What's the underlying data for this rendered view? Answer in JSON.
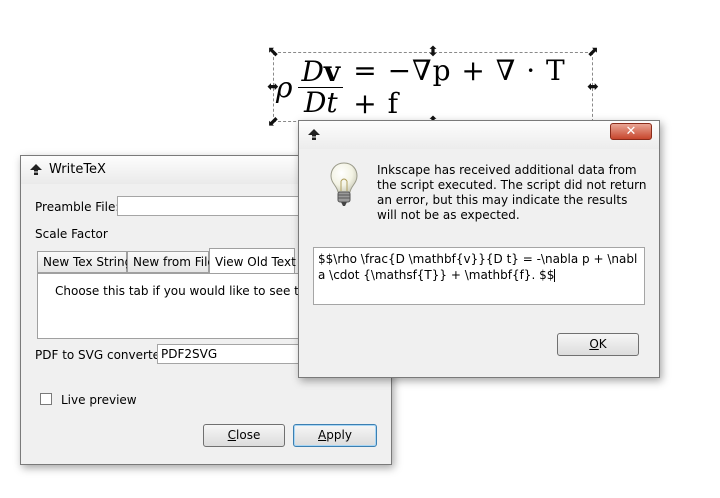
{
  "canvas": {
    "equation": {
      "rho": "ρ",
      "numerator_D": "D",
      "numerator_v": "v",
      "denominator": "Dt",
      "rest": "= −∇p + ∇ · T + f"
    }
  },
  "writetex": {
    "title": "WriteTeX",
    "preamble_label": "Preamble File:",
    "preamble_value": "",
    "scale_label": "Scale Factor",
    "tabs": [
      {
        "label": "New Tex String"
      },
      {
        "label": "New from File"
      },
      {
        "label": "View Old Text"
      }
    ],
    "tab_text": "Choose this tab if you would like to see the old",
    "converter_label": "PDF to SVG converter:",
    "converter_value": "PDF2SVG",
    "live_preview_label": "Live preview",
    "close_button": "lose",
    "close_underline": "C",
    "apply_button": "pply",
    "apply_underline": "A"
  },
  "message": {
    "close_glyph": "✕",
    "text": "Inkscape has received additional data from the script executed.  The script did not return an error, but this may indicate the results will not be as expected.",
    "data": "$$\\rho \\frac{D \\mathbf{v}}{D t} = -\\nabla p + \\nabla \\cdot {\\mathsf{T}} + \\mathbf{f}. $$",
    "ok_underline": "O",
    "ok_rest": "K"
  },
  "icons": {
    "app": "inkscape-icon",
    "bulb": "lightbulb-icon"
  }
}
